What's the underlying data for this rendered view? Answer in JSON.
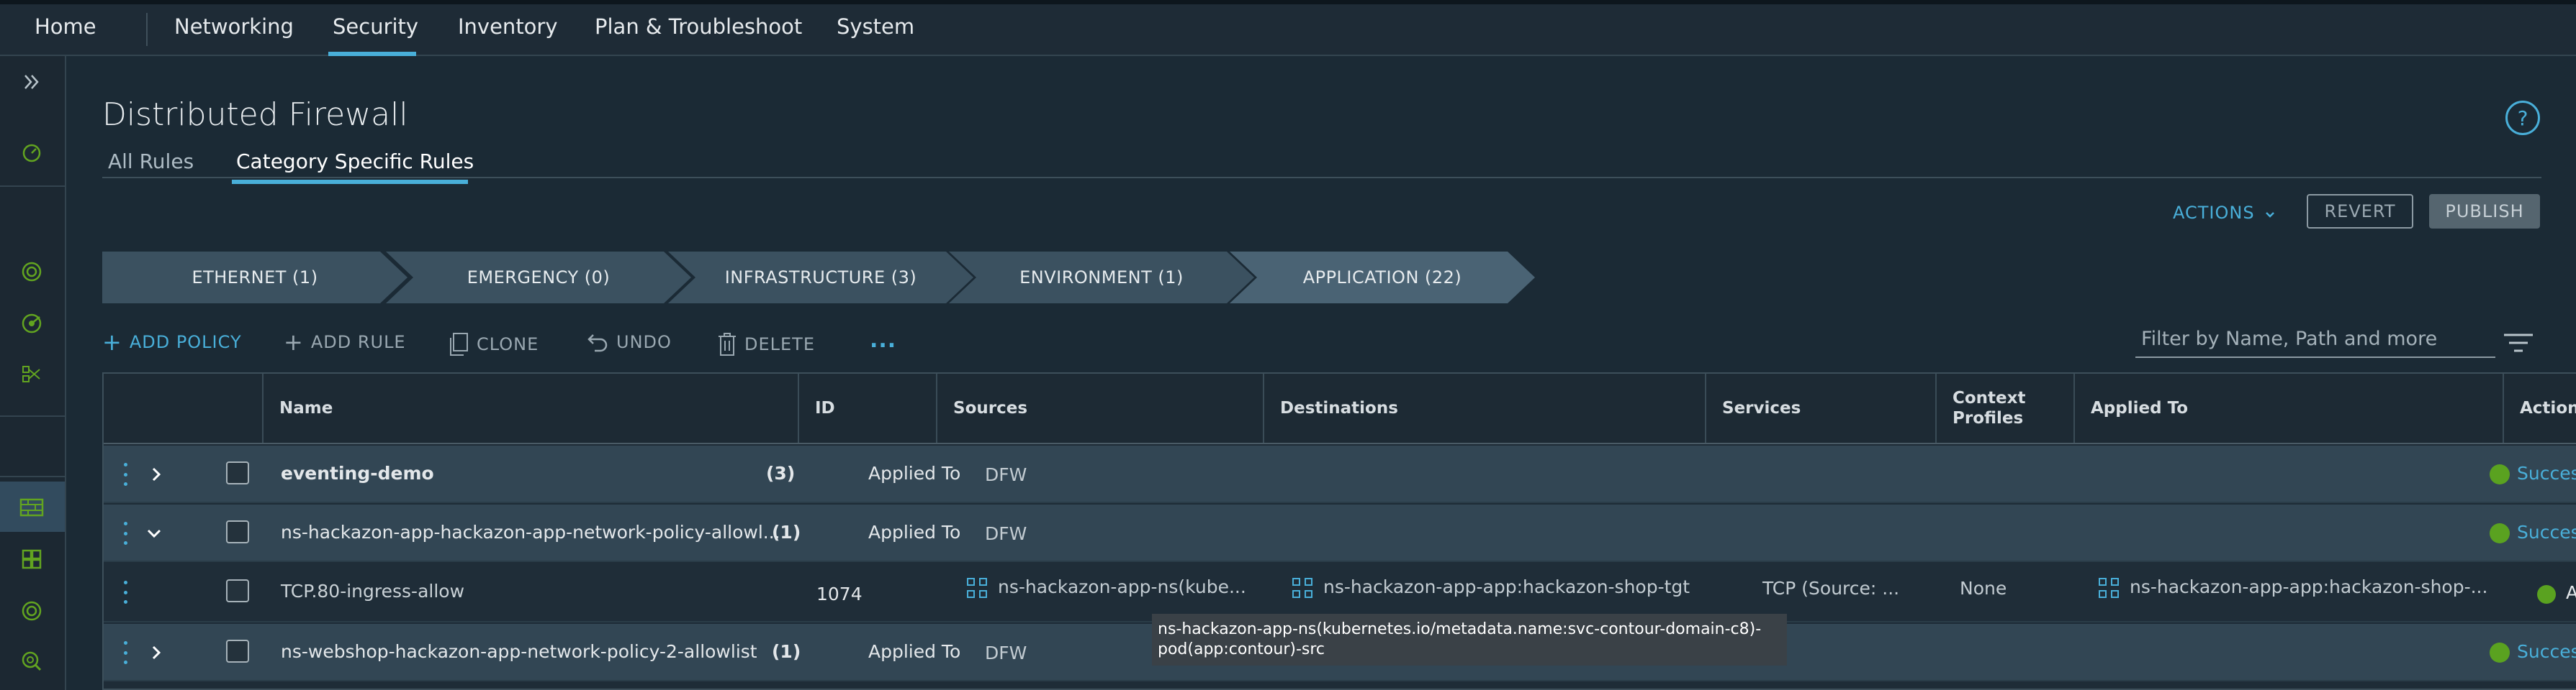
{
  "topnav": {
    "home": "Home",
    "items": [
      "Networking",
      "Security",
      "Inventory",
      "Plan & Troubleshoot",
      "System"
    ],
    "active": "Security"
  },
  "page": {
    "title": "Distributed Firewall",
    "help": "?",
    "tabs": [
      "All Rules",
      "Category Specific Rules"
    ],
    "active_tab": "Category Specific Rules"
  },
  "header_actions": {
    "actions": "ACTIONS",
    "revert": "REVERT",
    "publish": "PUBLISH"
  },
  "categories": [
    "ETHERNET (1)",
    "EMERGENCY (0)",
    "INFRASTRUCTURE (3)",
    "ENVIRONMENT (1)",
    "APPLICATION (22)"
  ],
  "active_category": "APPLICATION (22)",
  "toolbar": {
    "add_policy": "ADD POLICY",
    "add_rule": "ADD RULE",
    "clone": "CLONE",
    "undo": "UNDO",
    "delete": "DELETE",
    "more": "...",
    "filter_placeholder": "Filter by Name, Path and more"
  },
  "columns": [
    "Name",
    "ID",
    "Sources",
    "Destinations",
    "Services",
    "Context Profiles",
    "Applied To",
    "Action"
  ],
  "rows": [
    {
      "type": "policy",
      "name": "eventing-demo",
      "count": "(3)",
      "applied_label": "Applied To",
      "applied": "DFW",
      "status": "Succes"
    },
    {
      "type": "policy",
      "name": "ns-hackazon-app-hackazon-app-network-policy-allowl...",
      "count": "(1)",
      "applied_label": "Applied To",
      "applied": "DFW",
      "status": "Succes"
    },
    {
      "type": "rule",
      "name": "TCP.80-ingress-allow",
      "id": "1074",
      "source": "ns-hackazon-app-ns(kube...",
      "destination": "ns-hackazon-app-app:hackazon-shop-tgt",
      "service": "TCP (Source: ...",
      "context": "None",
      "applied": "ns-hackazon-app-app:hackazon-shop-...",
      "action": "A"
    },
    {
      "type": "policy",
      "name": "ns-webshop-hackazon-app-network-policy-2-allowlist",
      "count": "(1)",
      "applied_label": "Applied To",
      "applied": "DFW",
      "status": "Succes"
    }
  ],
  "tooltip": {
    "line1": "ns-hackazon-app-ns(kubernetes.io/metadata.name:svc-contour-domain-c8)-",
    "line2": "pod(app:contour)-src"
  },
  "colors": {
    "accent": "#49afd9",
    "success": "#5aa220",
    "bg": "#1b2a35"
  }
}
